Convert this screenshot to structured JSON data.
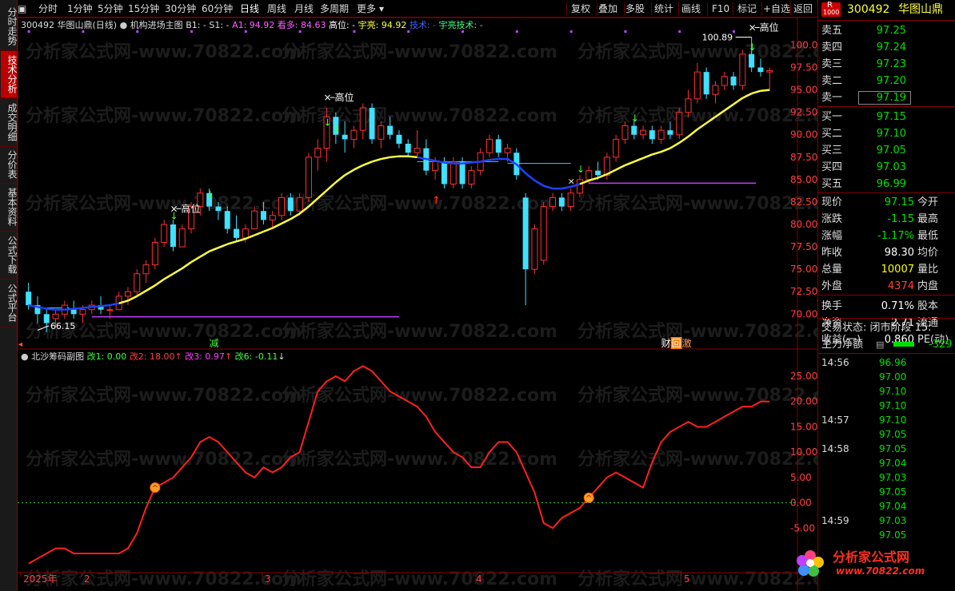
{
  "toolbar": {
    "left_items": [
      "分时",
      "1分钟",
      "5分钟",
      "15分钟",
      "30分钟",
      "60分钟",
      "日线",
      "周线",
      "月线",
      "多周期",
      "更多"
    ],
    "active": "日线",
    "right_items": [
      "复权",
      "叠加",
      "多股",
      "统计",
      "画线",
      "F10",
      "标记",
      "+自选",
      "返回"
    ]
  },
  "vtabs": [
    "分时走势",
    "技术分析",
    "成交明细",
    "分价表",
    "基本资料",
    "公式下载",
    "公式平台"
  ],
  "vtab_active": "技术分析",
  "main_info": {
    "title": "300492 华图山鼎(日线)",
    "formula": "机构进场主图",
    "b1": "B1: -",
    "s1": "S1: -",
    "a1": "A1: 94.92",
    "kanduo": "看多: 84.63",
    "gaowei": "高位: -",
    "yuliang": "宇亮: 94.92",
    "jishu": "技术: -",
    "yuliangjishu": "宇亮技术: -"
  },
  "sub_info": {
    "title": "北沙筹码副图",
    "g1": "改1: 0.00",
    "g2": "改2: 18.00",
    "g3": "改3: 0.97",
    "g6": "改6: -0.11"
  },
  "annotations": {
    "high_price": "100.89",
    "low_price": "66.15",
    "gaowei1": "高位",
    "gaowei2": "高位",
    "gaowei3": "高位",
    "jian": "减",
    "cai": "财",
    "hui": "回",
    "ji": "激",
    "year": "2025年",
    "m2": "2",
    "m3": "3",
    "m4": "4",
    "m5": "5"
  },
  "watermark": "分析家公式网-www.70822.com",
  "price_axis": [
    "100.0",
    "97.50",
    "95.00",
    "92.50",
    "90.00",
    "87.50",
    "85.00",
    "82.50",
    "80.00",
    "77.50",
    "75.00",
    "72.50",
    "70.00"
  ],
  "sub_axis": [
    "25.00",
    "20.00",
    "15.00",
    "10.00",
    "5.00",
    "0.00",
    "-5.00"
  ],
  "chart_data": [
    {
      "type": "candlestick",
      "title": "300492 华图山鼎(日线)",
      "ylim": [
        67,
        102
      ],
      "ohlc": [
        [
          72.5,
          73.5,
          70.5,
          71.0
        ],
        [
          71.0,
          72.0,
          69.0,
          70.0
        ],
        [
          70.0,
          70.5,
          68.0,
          69.0
        ],
        [
          69.5,
          70.5,
          68.5,
          70.0
        ],
        [
          70.0,
          71.5,
          69.5,
          71.0
        ],
        [
          70.5,
          71.5,
          69.5,
          70.0
        ],
        [
          70.0,
          71.0,
          69.0,
          70.5
        ],
        [
          70.5,
          71.5,
          70.0,
          71.0
        ],
        [
          71.0,
          72.0,
          70.0,
          70.5
        ],
        [
          70.5,
          71.0,
          69.5,
          70.5
        ],
        [
          70.5,
          72.5,
          70.5,
          72.0
        ],
        [
          72.0,
          73.0,
          71.0,
          72.5
        ],
        [
          72.5,
          75.0,
          72.0,
          74.5
        ],
        [
          74.5,
          76.0,
          73.5,
          75.5
        ],
        [
          75.5,
          78.5,
          75.0,
          78.0
        ],
        [
          78.0,
          80.5,
          77.5,
          80.0
        ],
        [
          80.0,
          80.5,
          77.0,
          77.5
        ],
        [
          77.5,
          80.0,
          77.5,
          79.5
        ],
        [
          79.5,
          82.5,
          79.0,
          82.0
        ],
        [
          82.0,
          84.0,
          81.0,
          83.5
        ],
        [
          83.5,
          84.0,
          81.5,
          82.0
        ],
        [
          82.0,
          82.5,
          80.5,
          81.5
        ],
        [
          81.5,
          82.0,
          79.0,
          79.5
        ],
        [
          79.5,
          81.0,
          78.0,
          78.5
        ],
        [
          78.5,
          80.0,
          78.0,
          79.5
        ],
        [
          79.5,
          82.0,
          79.5,
          81.5
        ],
        [
          81.5,
          82.5,
          80.0,
          80.5
        ],
        [
          80.5,
          81.5,
          79.5,
          81.0
        ],
        [
          81.0,
          83.5,
          80.5,
          83.0
        ],
        [
          83.0,
          83.5,
          81.0,
          81.5
        ],
        [
          81.5,
          83.5,
          81.0,
          83.0
        ],
        [
          83.0,
          88.0,
          82.5,
          87.5
        ],
        [
          87.5,
          89.5,
          86.0,
          88.5
        ],
        [
          88.5,
          93.0,
          87.0,
          92.0
        ],
        [
          92.0,
          92.5,
          89.0,
          90.0
        ],
        [
          90.0,
          91.5,
          88.0,
          89.5
        ],
        [
          89.5,
          91.0,
          88.5,
          90.5
        ],
        [
          90.5,
          93.5,
          89.5,
          93.0
        ],
        [
          93.0,
          93.5,
          89.0,
          89.5
        ],
        [
          89.5,
          91.5,
          88.5,
          91.0
        ],
        [
          91.0,
          92.0,
          89.5,
          90.0
        ],
        [
          90.0,
          90.5,
          88.5,
          89.0
        ],
        [
          89.0,
          89.5,
          87.5,
          88.0
        ],
        [
          88.0,
          90.5,
          87.5,
          88.5
        ],
        [
          88.5,
          89.5,
          85.5,
          86.0
        ],
        [
          86.0,
          87.5,
          85.0,
          87.0
        ],
        [
          87.0,
          87.5,
          84.0,
          84.5
        ],
        [
          84.5,
          87.5,
          84.0,
          87.0
        ],
        [
          87.0,
          87.5,
          84.0,
          84.5
        ],
        [
          84.5,
          86.5,
          84.0,
          86.0
        ],
        [
          86.0,
          88.5,
          85.5,
          88.0
        ],
        [
          88.0,
          90.0,
          87.5,
          89.5
        ],
        [
          89.5,
          90.0,
          87.5,
          88.0
        ],
        [
          88.0,
          89.0,
          87.0,
          88.5
        ],
        [
          88.0,
          88.5,
          85.0,
          85.5
        ],
        [
          83.0,
          83.5,
          71.0,
          75.0
        ],
        [
          75.0,
          80.0,
          74.5,
          79.5
        ],
        [
          76.0,
          82.5,
          75.5,
          82.0
        ],
        [
          82.0,
          83.5,
          81.5,
          83.0
        ],
        [
          83.0,
          83.5,
          81.5,
          82.0
        ],
        [
          82.0,
          84.0,
          81.5,
          83.5
        ],
        [
          83.5,
          85.5,
          83.0,
          85.0
        ],
        [
          85.0,
          86.5,
          84.5,
          86.0
        ],
        [
          86.0,
          87.0,
          85.0,
          85.5
        ],
        [
          85.5,
          88.0,
          85.0,
          87.5
        ],
        [
          87.5,
          90.0,
          87.0,
          89.5
        ],
        [
          89.5,
          91.5,
          89.0,
          91.0
        ],
        [
          91.0,
          91.5,
          89.5,
          90.0
        ],
        [
          90.0,
          91.0,
          89.5,
          90.5
        ],
        [
          90.5,
          91.0,
          89.0,
          89.5
        ],
        [
          89.5,
          91.0,
          89.0,
          90.5
        ],
        [
          90.5,
          91.5,
          89.5,
          90.0
        ],
        [
          90.0,
          93.0,
          89.5,
          92.5
        ],
        [
          92.5,
          95.0,
          92.0,
          94.0
        ],
        [
          94.0,
          98.0,
          93.5,
          97.0
        ],
        [
          97.0,
          97.5,
          94.0,
          94.5
        ],
        [
          94.5,
          96.0,
          93.5,
          95.5
        ],
        [
          95.5,
          97.0,
          95.0,
          96.5
        ],
        [
          96.5,
          97.0,
          95.0,
          95.5
        ],
        [
          95.5,
          99.5,
          95.0,
          99.0
        ],
        [
          99.0,
          100.89,
          97.0,
          97.5
        ],
        [
          97.5,
          98.5,
          96.5,
          97.0
        ],
        [
          97.0,
          97.5,
          95.0,
          97.15
        ]
      ],
      "ma_line": [
        71.0,
        70.8,
        70.6,
        70.5,
        70.5,
        70.6,
        70.7,
        70.8,
        70.9,
        71.0,
        71.2,
        71.5,
        72.0,
        72.6,
        73.2,
        73.9,
        74.5,
        75.1,
        75.8,
        76.4,
        77.0,
        77.4,
        77.8,
        78.1,
        78.4,
        78.8,
        79.2,
        79.6,
        80.1,
        80.6,
        81.2,
        82.0,
        82.9,
        83.8,
        84.7,
        85.5,
        86.1,
        86.6,
        87.0,
        87.3,
        87.5,
        87.6,
        87.6,
        87.5,
        87.3,
        87.1,
        86.9,
        86.8,
        86.8,
        86.9,
        87.0,
        87.2,
        87.3,
        87.3,
        86.7,
        85.7,
        84.9,
        84.3,
        84.0,
        84.0,
        84.2,
        84.5,
        84.9,
        85.2,
        85.6,
        86.1,
        86.6,
        87.0,
        87.4,
        87.8,
        88.1,
        88.5,
        89.1,
        89.8,
        90.6,
        91.3,
        92.0,
        92.7,
        93.4,
        94.1,
        94.6,
        94.9,
        95.0
      ]
    },
    {
      "type": "line",
      "title": "北沙筹码副图",
      "ylim": [
        -13,
        28
      ],
      "values": [
        -12,
        -11,
        -10,
        -9,
        -9,
        -10,
        -10,
        -10,
        -10,
        -10,
        -10,
        -9,
        -6,
        -1,
        3,
        4,
        5,
        7,
        9,
        12,
        13,
        12,
        10,
        8,
        6,
        5,
        7,
        6,
        7,
        9,
        10,
        16,
        22,
        24,
        25,
        24,
        26,
        27,
        26,
        24,
        22,
        21,
        20,
        19,
        17,
        14,
        12,
        10,
        9,
        7,
        7,
        10,
        12,
        12,
        10,
        6,
        2,
        -4,
        -5,
        -3,
        -2,
        -1,
        1,
        3,
        5,
        6,
        5,
        4,
        3,
        8,
        12,
        14,
        15,
        16,
        15,
        15,
        16,
        17,
        18,
        19,
        19,
        20,
        20
      ],
      "zero_line": 0,
      "markers_at": [
        14,
        62
      ]
    }
  ],
  "right_panel": {
    "code": "300492",
    "name": "华图山鼎",
    "badge_r": "R",
    "badge_n": "1000",
    "sells": [
      {
        "label": "卖五",
        "price": "97.25"
      },
      {
        "label": "卖四",
        "price": "97.24"
      },
      {
        "label": "卖三",
        "price": "97.23"
      },
      {
        "label": "卖二",
        "price": "97.20"
      },
      {
        "label": "卖一",
        "price": "97.19"
      }
    ],
    "buys": [
      {
        "label": "买一",
        "price": "97.15"
      },
      {
        "label": "买二",
        "price": "97.10"
      },
      {
        "label": "买三",
        "price": "97.05"
      },
      {
        "label": "买四",
        "price": "97.03"
      },
      {
        "label": "买五",
        "price": "96.99"
      }
    ],
    "stats": [
      {
        "label": "现价",
        "value": "97.15",
        "color": "green",
        "l2": "今开"
      },
      {
        "label": "涨跌",
        "value": "-1.15",
        "color": "green",
        "l2": "最高"
      },
      {
        "label": "涨幅",
        "value": "-1.17%",
        "color": "green",
        "l2": "最低"
      },
      {
        "label": "昨收",
        "value": "98.30",
        "color": "white",
        "l2": "均价"
      },
      {
        "label": "总量",
        "value": "10007",
        "color": "yellow",
        "l2": "量比"
      },
      {
        "label": "外盘",
        "value": "4374",
        "color": "red",
        "l2": "内盘"
      },
      {
        "label": "换手",
        "value": "0.71%",
        "color": "white",
        "l2": "股本"
      },
      {
        "label": "净资",
        "value": "2.71",
        "color": "white",
        "l2": "流通"
      },
      {
        "label": "收益(一)",
        "value": "0.860",
        "color": "white",
        "l2": "PE(动)"
      }
    ],
    "trade_state": "交易状态: 闭市阶段 15:",
    "main_net": "主力净额",
    "main_net_val": "-329",
    "ticks": [
      {
        "time": "14:56",
        "price": "96.96"
      },
      {
        "time": "",
        "price": "97.00"
      },
      {
        "time": "",
        "price": "97.10"
      },
      {
        "time": "",
        "price": "97.10"
      },
      {
        "time": "14:57",
        "price": "97.10"
      },
      {
        "time": "",
        "price": "97.05"
      },
      {
        "time": "14:58",
        "price": "97.05"
      },
      {
        "time": "",
        "price": "97.04"
      },
      {
        "time": "",
        "price": "97.03"
      },
      {
        "time": "",
        "price": "97.05"
      },
      {
        "time": "",
        "price": "97.04"
      },
      {
        "time": "14:59",
        "price": "97.03"
      },
      {
        "time": "",
        "price": "97.05"
      }
    ],
    "logo_text": "分析家公式网",
    "logo_url": "www.70822.com"
  }
}
